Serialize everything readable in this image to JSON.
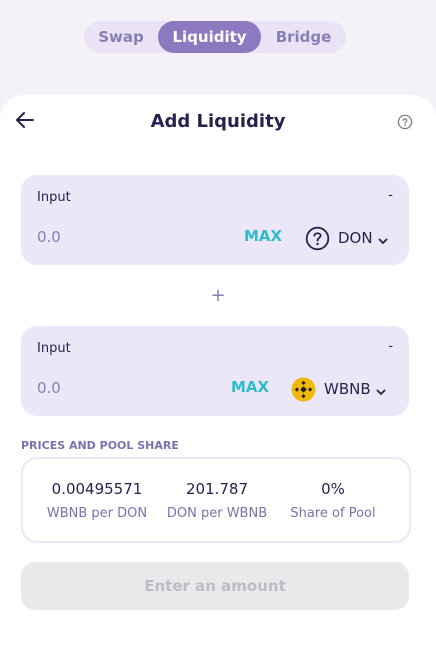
{
  "tabs": [
    {
      "label": "Swap",
      "active": false
    },
    {
      "label": "Liquidity",
      "active": true
    },
    {
      "label": "Bridge",
      "active": false
    }
  ],
  "header": {
    "title": "Add Liquidity",
    "back_icon": "arrow-left-icon",
    "help_icon": "question-circle-icon"
  },
  "inputs": [
    {
      "label": "Input",
      "balance": "-",
      "placeholder": "0.0",
      "value": "",
      "max_label": "MAX",
      "token_symbol": "DON",
      "token_icon": "unknown-token-icon"
    },
    {
      "label": "Input",
      "balance": "-",
      "placeholder": "0.0",
      "value": "",
      "max_label": "MAX",
      "token_symbol": "WBNB",
      "token_icon": "bnb-token-icon"
    }
  ],
  "plus_symbol": "+",
  "pool": {
    "section_title": "PRICES AND POOL SHARE",
    "stats": [
      {
        "value": "0.00495571",
        "label": "WBNB per DON"
      },
      {
        "value": "201.787",
        "label": "DON per WBNB"
      },
      {
        "value": "0%",
        "label": "Share of Pool"
      }
    ]
  },
  "cta": {
    "label": "Enter an amount",
    "disabled": true
  },
  "colors": {
    "accent": "#8c79bf",
    "text_primary": "#2a1f4d",
    "text_secondary": "#7e6fae",
    "max_cyan": "#2bbdcc",
    "panel_bg": "#ece7f6",
    "bnb_yellow": "#f0b90b"
  }
}
